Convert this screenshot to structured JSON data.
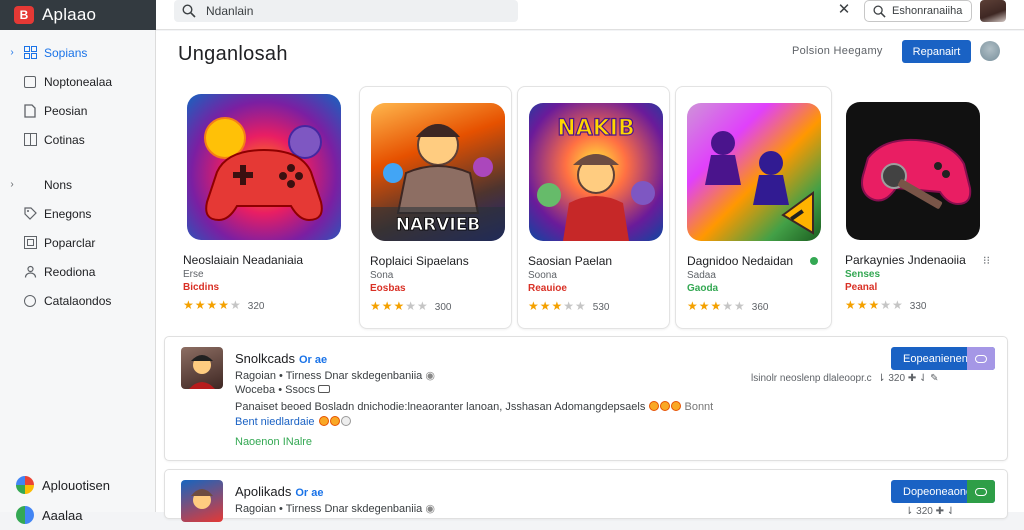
{
  "app": {
    "name": "Aplaao",
    "logo_letter": "B"
  },
  "sidebar": {
    "items": [
      {
        "label": "Sopians",
        "icon": "grid-icon",
        "active": true
      },
      {
        "label": "Noptonealaa",
        "icon": "list-icon",
        "active": false
      },
      {
        "label": "Peosian",
        "icon": "document-icon",
        "active": false
      },
      {
        "label": "Cotinas",
        "icon": "columns-icon",
        "active": false
      }
    ],
    "items2": [
      {
        "label": "Nons",
        "icon": "",
        "active": false
      },
      {
        "label": "Enegons",
        "icon": "tag-icon",
        "active": false
      },
      {
        "label": "Poparclar",
        "icon": "box-icon",
        "active": false
      },
      {
        "label": "Reodiona",
        "icon": "person-icon",
        "active": false
      },
      {
        "label": "Catalaondos",
        "icon": "circle-icon",
        "active": false
      }
    ],
    "footer": [
      {
        "label": "Aplouotisen"
      },
      {
        "label": "Aaalaa"
      }
    ]
  },
  "topbar": {
    "search_value": "Ndanlain",
    "search_pill": "Eshonranaiiha"
  },
  "header": {
    "title": "Unganlosah",
    "link": "Polsion Heegamy",
    "button": "Repanairt"
  },
  "cards": [
    {
      "title": "Neoslaiain Neadaniaia",
      "sub": "Erse",
      "tag": "Bicdins",
      "tag_color": "#d93025",
      "stars": 4.5,
      "count": "320",
      "boxed": false
    },
    {
      "title": "Roplaici Sipaelans",
      "sub": "Sona",
      "tag": "Eosbas",
      "tag_color": "#d93025",
      "stars": 3.5,
      "count": "300",
      "boxed": true
    },
    {
      "title": "Saosian Paelan",
      "sub": "Soona",
      "tag": "Reauioe",
      "tag_color": "#d93025",
      "stars": 3.5,
      "count": "530",
      "boxed": true
    },
    {
      "title": "Dagnidoo Nedaidan",
      "sub": "Sadaa",
      "tag": "Gaoda",
      "tag_color": "#34a853",
      "stars": 3.0,
      "count": "360",
      "boxed": true
    },
    {
      "title": "Parkaynies Jndenaoiia",
      "sub": "Senses",
      "tag": "Peanal",
      "tag_color": "#d93025",
      "stars": 3.5,
      "count": "330",
      "boxed": false
    }
  ],
  "rows": [
    {
      "name": "Snolkcads",
      "badge": "Or ae",
      "line1": "Ragoian • Tirness Dnar skdegenbaniia",
      "line2": "Woceba • Ssocs",
      "line3": "Panaiset beoed Bosladn dnichodie:lneaoranter lanoan, Jsshasan Adomangdepsaels",
      "line3b": "Bonnt",
      "line4": "Bent niedlardaie",
      "line5": "Naoenon INalre",
      "meta": "lsinolr neoslenp dlaleoopr.c",
      "meta2": "320",
      "button": "Eopeanienen",
      "tail_color": "#a597e6"
    },
    {
      "name": "Apolikads",
      "badge": "Or ae",
      "line1": "Ragoian • Tirness Dnar skdegenbaniia",
      "meta2": "320",
      "button": "Dopeoneaonen",
      "tail_color": "#2e9e47"
    }
  ],
  "colors": {
    "accent": "#1a62c4",
    "brand_bar": "#333a40",
    "star": "#f4a100"
  }
}
